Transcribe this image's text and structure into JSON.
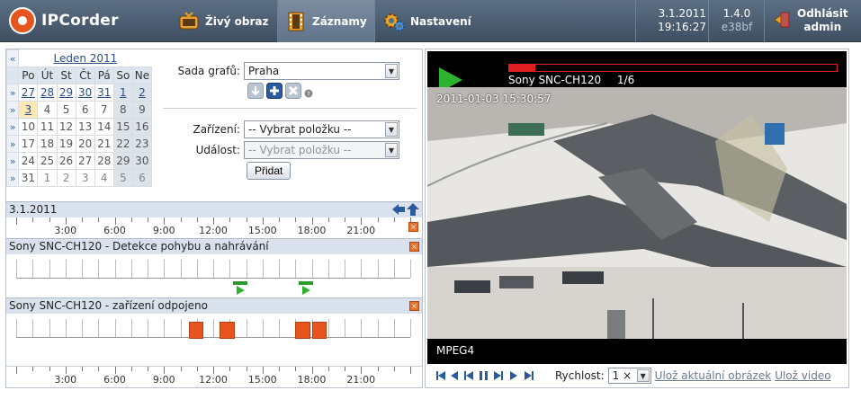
{
  "app": {
    "title": "IPCorder"
  },
  "nav": [
    {
      "label": "Živý obraz"
    },
    {
      "label": "Záznamy"
    },
    {
      "label": "Nastavení"
    }
  ],
  "status": {
    "date": "3.1.2011",
    "time": "19:16:27",
    "version": "1.4.0",
    "build": "e38bf"
  },
  "logout": {
    "label": "Odhlásit",
    "user": "admin"
  },
  "calendar": {
    "month": "Leden 2011",
    "prev": "«",
    "days": [
      "Po",
      "Út",
      "St",
      "Čt",
      "Pá",
      "So",
      "Ne"
    ],
    "week_arrow": "»",
    "weeks": [
      [
        "27",
        "28",
        "29",
        "30",
        "31",
        "1",
        "2"
      ],
      [
        "3",
        "4",
        "5",
        "6",
        "7",
        "8",
        "9"
      ],
      [
        "10",
        "11",
        "12",
        "13",
        "14",
        "15",
        "16"
      ],
      [
        "17",
        "18",
        "19",
        "20",
        "21",
        "22",
        "23"
      ],
      [
        "24",
        "25",
        "26",
        "27",
        "28",
        "29",
        "30"
      ],
      [
        "31",
        "1",
        "2",
        "3",
        "4",
        "5",
        "6"
      ]
    ]
  },
  "form": {
    "graph_set_label": "Sada grafů:",
    "graph_set_value": "Praha",
    "device_label": "Zařízení:",
    "device_value": "-- Vybrat položku --",
    "event_label": "Událost:",
    "event_value": "-- Vybrat položku --",
    "add_button": "Přidat"
  },
  "timeline": {
    "date": "3.1.2011",
    "hours": [
      "3:00",
      "6:00",
      "9:00",
      "12:00",
      "15:00",
      "18:00",
      "21:00"
    ],
    "tracks": [
      {
        "title": "Sony SNC-CH120 - Detekce pohybu a nahrávání"
      },
      {
        "title": "Sony SNC-CH120 - zařízení odpojeno"
      }
    ]
  },
  "video": {
    "camera": "Sony SNC-CH120",
    "counter": "1/6",
    "timestamp": "2011-01-03 15:30:57",
    "codec": "MPEG4",
    "speed_label": "Rychlost:",
    "speed_value": "1 ×",
    "save_image": "Ulož aktuální obrázek",
    "save_video": "Ulož video"
  }
}
